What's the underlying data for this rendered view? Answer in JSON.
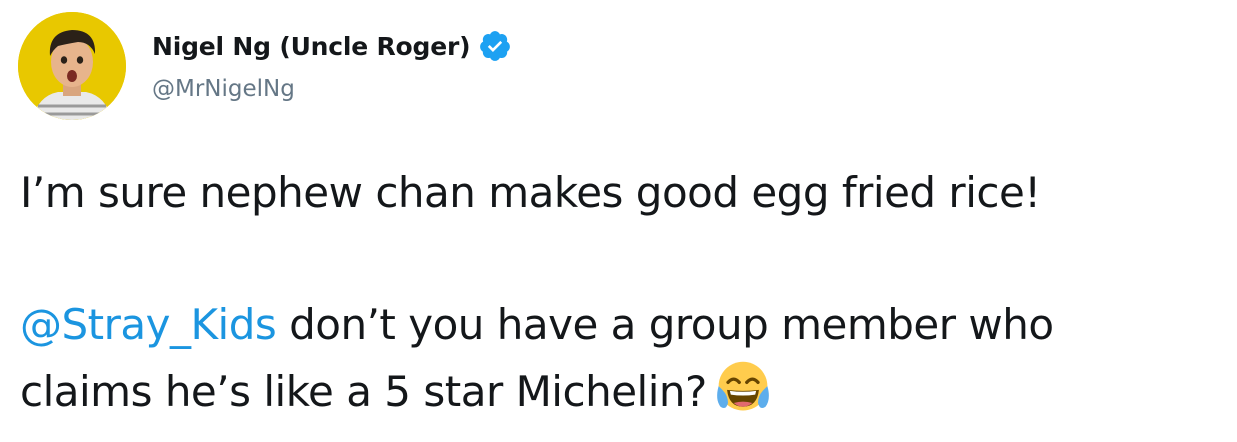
{
  "tweet": {
    "author": {
      "display_name": "Nigel Ng (Uncle Roger)",
      "handle": "@MrNigelNg",
      "verified": true,
      "avatar_icon": "avatar-photo",
      "verified_icon": "verified-badge-icon"
    },
    "text": {
      "line1": "I’m sure nephew chan makes good egg fried rice!",
      "mention": "@Stray_Kids",
      "line2_rest": " don’t you have a group member who",
      "line3": "claims he’s like a 5 star Michelin?",
      "emoji": "face-with-tears-of-joy"
    }
  },
  "colors": {
    "text": "#14171a",
    "secondary": "#657786",
    "mention": "#1b95e0",
    "verified": "#1da1f2",
    "avatar_bg": "#e8c800"
  }
}
